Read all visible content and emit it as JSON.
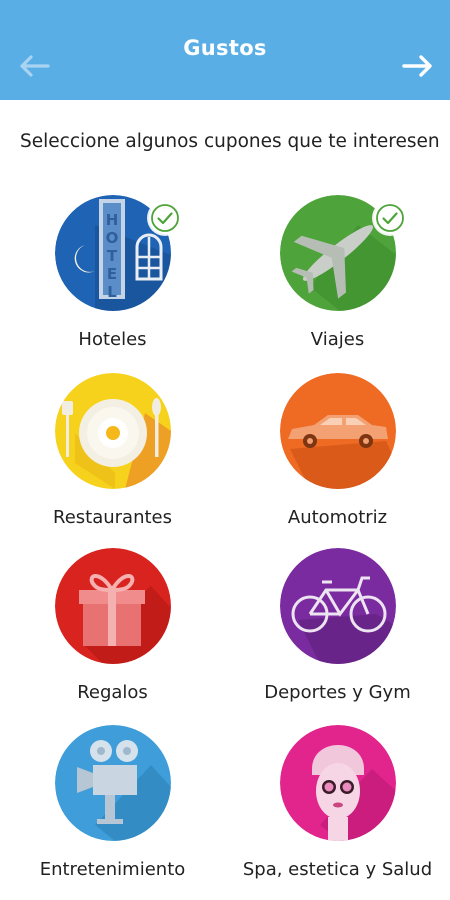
{
  "header": {
    "title": "Gustos",
    "back_icon": "arrow-left-icon",
    "next_icon": "arrow-right-icon",
    "background": "#5aaee6"
  },
  "instruction": "Seleccione algunos cupones que te interesen",
  "categories": [
    {
      "label": "Hoteles",
      "icon": "hotel-icon",
      "color": "#1f63b4",
      "selected": true
    },
    {
      "label": "Viajes",
      "icon": "airplane-icon",
      "color": "#4ea43a",
      "selected": true
    },
    {
      "label": "Restaurantes",
      "icon": "plate-icon",
      "color": "#f7d21c",
      "selected": false
    },
    {
      "label": "Automotriz",
      "icon": "car-icon",
      "color": "#ef6a22",
      "selected": false
    },
    {
      "label": "Regalos",
      "icon": "gift-icon",
      "color": "#d9231f",
      "selected": false
    },
    {
      "label": "Deportes y Gym",
      "icon": "bicycle-icon",
      "color": "#7b2ba0",
      "selected": false
    },
    {
      "label": "Entretenimiento",
      "icon": "movie-camera-icon",
      "color": "#3f9ed9",
      "selected": false
    },
    {
      "label": "Spa, estetica y Salud",
      "icon": "spa-face-icon",
      "color": "#e1258d",
      "selected": false
    }
  ]
}
